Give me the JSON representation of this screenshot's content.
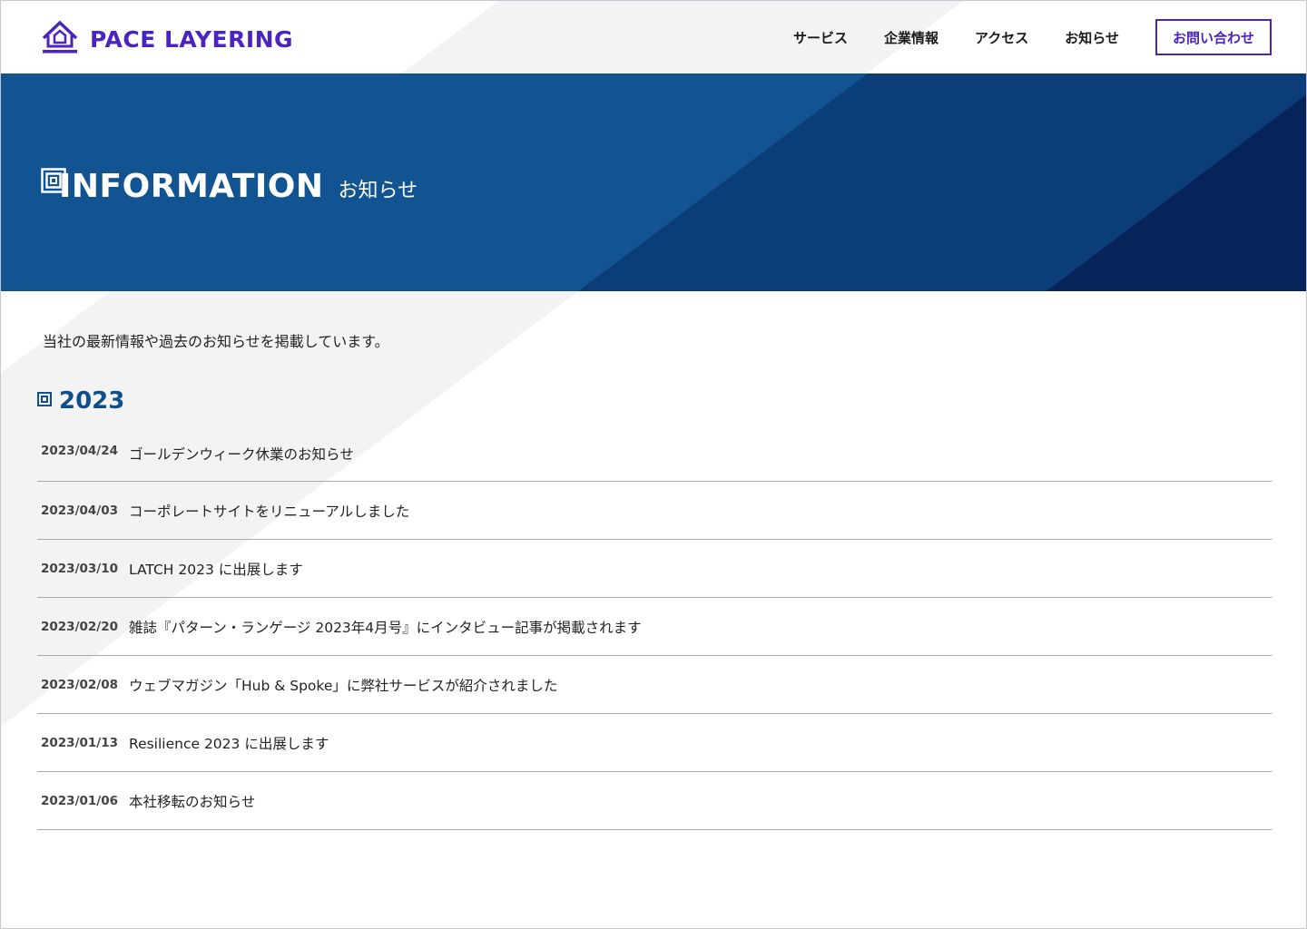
{
  "header": {
    "logo_text": "PACE LAYERING",
    "nav": [
      "サービス",
      "企業情報",
      "アクセス",
      "お知らせ"
    ],
    "contact_label": "お問い合わせ"
  },
  "hero": {
    "title_en": "INFORMATION",
    "title_ja": "お知らせ"
  },
  "main": {
    "intro": "当社の最新情報や過去のお知らせを掲載しています。",
    "year": "2023",
    "news": [
      {
        "date": "2023/04/24",
        "title": "ゴールデンウィーク休業のお知らせ"
      },
      {
        "date": "2023/04/03",
        "title": "コーポレートサイトをリニューアルしました"
      },
      {
        "date": "2023/03/10",
        "title": "LATCH 2023 に出展します"
      },
      {
        "date": "2023/02/20",
        "title": "雑誌『パターン・ランゲージ 2023年4月号』にインタビュー記事が掲載されます"
      },
      {
        "date": "2023/02/08",
        "title": "ウェブマガジン「Hub & Spoke」に弊社サービスが紹介されました"
      },
      {
        "date": "2023/01/13",
        "title": "Resilience 2023 に出展します"
      },
      {
        "date": "2023/01/06",
        "title": "本社移転のお知らせ"
      }
    ]
  },
  "colors": {
    "brand": "#4a23c0",
    "hero_blue": "#125491",
    "hero_mid": "#0b3d78",
    "hero_dark": "#07245a",
    "year_blue": "#0f4e8c"
  },
  "icons": {
    "logo": "house-logo-icon",
    "hero": "square-target-icon",
    "year": "square-target-icon"
  }
}
